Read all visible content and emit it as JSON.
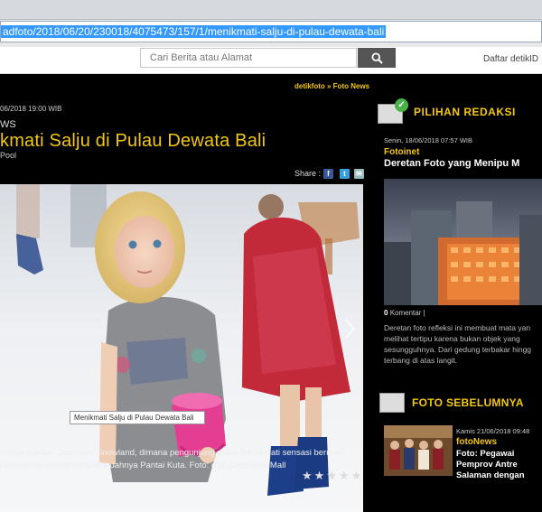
{
  "browser": {
    "url": "adfoto/2018/06/20/230018/4075473/157/1/menikmati-salju-di-pulau-dewata-bali"
  },
  "header": {
    "search_placeholder": "Cari Berita atau Alamat",
    "daftar_label": "Daftar detikID"
  },
  "article": {
    "breadcrumb": "detikfoto » Foto News",
    "date": "06/2018 19:00 WIB",
    "section": "WS",
    "title": "kmati Salju di Pulau Dewata Bali",
    "credit": "Pool",
    "share_label": "Share :",
    "photo_caption": "Menikmati Salju di Pulau Dewata Bali",
    "description_line1": "menghadirkan Discovery Snowland, dimana pengunjung dapat menikmati sensasi bermain",
    "description_line2": "l menikmati pemandangan indahnya Pantai Kuta. Foto: dok. Discovery Mall",
    "stars": "★★★★★"
  },
  "sidebar": {
    "pilihan_title": "PILIHAN REDAKSI",
    "item1": {
      "date": "Senin, 18/06/2018 07:57 WIB",
      "source": "Fotoinet",
      "title": "Deretan Foto yang Menipu M",
      "comments_count": "0",
      "comments_label": "Komentar",
      "desc_line1": "Deretan foto refleksi ini membuat mata yan",
      "desc_line2": "melihat tertipu karena bukan objek yang",
      "desc_line3": "sesungguhnya. Dari gedung terbakar hingg",
      "desc_line4": "terbang di atas langit."
    },
    "sebelumnya_title": "FOTO SEBELUMNYA",
    "item2": {
      "date": "Kamis 21/06/2018 09:48",
      "source": "fotoNews",
      "title_line1": "Foto: Pegawai",
      "title_line2": "Pemprov Antre",
      "title_line3": "Salaman dengan"
    }
  },
  "colors": {
    "accent": "#f2c80f",
    "page_bg": "#000000",
    "url_highlight": "#3399ff"
  }
}
